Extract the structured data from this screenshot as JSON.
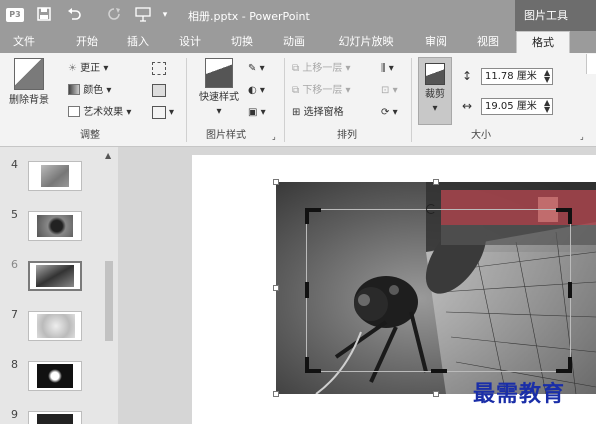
{
  "window": {
    "title": "相册.pptx - PowerPoint",
    "context_tab_label": "图片工具",
    "ppt_badge": "P3"
  },
  "tabs": [
    "文件",
    "开始",
    "插入",
    "设计",
    "切换",
    "动画",
    "幻灯片放映",
    "审阅",
    "视图",
    "格式"
  ],
  "ribbon": {
    "adjust": {
      "remove_bg": "删除背景",
      "corrections": "更正",
      "color": "颜色",
      "artistic": "艺术效果",
      "group": "调整"
    },
    "styles": {
      "quick_styles": "快速样式",
      "group": "图片样式"
    },
    "arrange": {
      "bring_forward": "上移一层",
      "send_backward": "下移一层",
      "selection_pane": "选择窗格",
      "group": "排列"
    },
    "size": {
      "crop": "裁剪",
      "height": "11.78 厘米",
      "width": "19.05 厘米",
      "group": "大小"
    }
  },
  "slides": [
    {
      "num": "4"
    },
    {
      "num": "5"
    },
    {
      "num": "6"
    },
    {
      "num": "7"
    },
    {
      "num": "8"
    },
    {
      "num": "9"
    }
  ],
  "watermark": "最需教育",
  "colors": {
    "ribbon_bg": "#f3f3f3",
    "titlebar": "#9b9b9b",
    "context_tab": "#6d6d6d",
    "watermark": "#1a2ea8"
  }
}
